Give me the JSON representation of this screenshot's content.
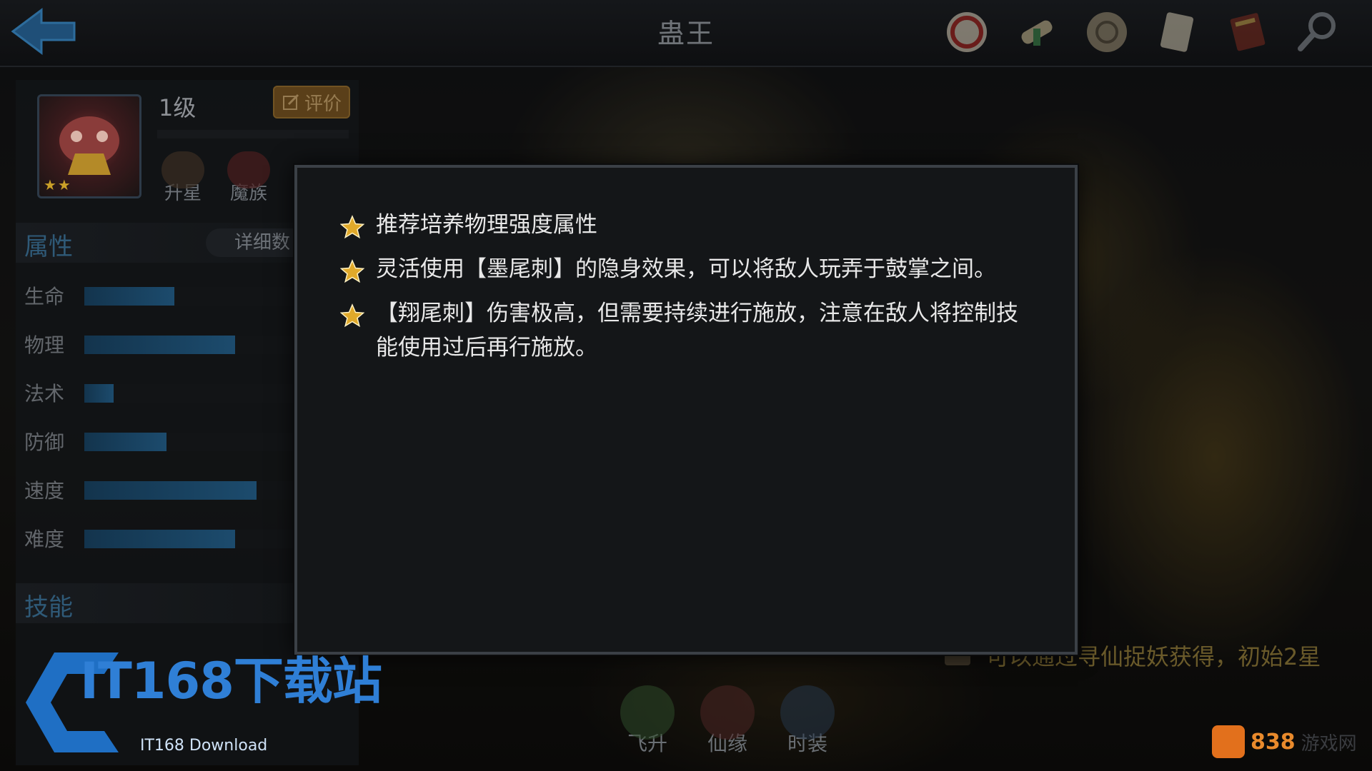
{
  "header": {
    "title": "蛊王",
    "icons": [
      "trial-seal-icon",
      "scroll-icon",
      "medallion-icon",
      "parchment-icon",
      "book-icon",
      "magnifier-icon"
    ]
  },
  "hero": {
    "level": "1级",
    "stars": "★★",
    "rate_label": "评价",
    "upgrade_star_label": "升星",
    "race_label": "魔族"
  },
  "attributes": {
    "title": "属性",
    "detail_label": "详细数",
    "stats": [
      {
        "label": "生命",
        "value": 0.34
      },
      {
        "label": "物理",
        "value": 0.57
      },
      {
        "label": "法术",
        "value": 0.11
      },
      {
        "label": "防御",
        "value": 0.31
      },
      {
        "label": "速度",
        "value": 0.65
      },
      {
        "label": "难度",
        "value": 0.57
      }
    ]
  },
  "skills": {
    "title": "技能"
  },
  "dialog": {
    "tips": [
      "推荐培养物理强度属性",
      "灵活使用【墨尾刺】的隐身效果，可以将敌人玩弄于鼓掌之间。",
      "【翔尾刺】伤害极高，但需要持续进行施放，注意在敌人将控制技能使用过后再行施放。"
    ]
  },
  "obtain_caption": "可以通过寻仙捉妖获得，初始2星",
  "bottom_buttons": {
    "ascend": "飞升",
    "fate": "仙缘",
    "costume": "时装"
  },
  "watermark": {
    "main": "IT168下载站",
    "sub": "IT168 Download"
  },
  "corner_logo": {
    "num": "838",
    "rest": "游戏网"
  },
  "colors": {
    "accent_blue": "#1c4b6d",
    "star_gold": "#e0a92a",
    "watermark_blue": "#2f7fd6"
  }
}
